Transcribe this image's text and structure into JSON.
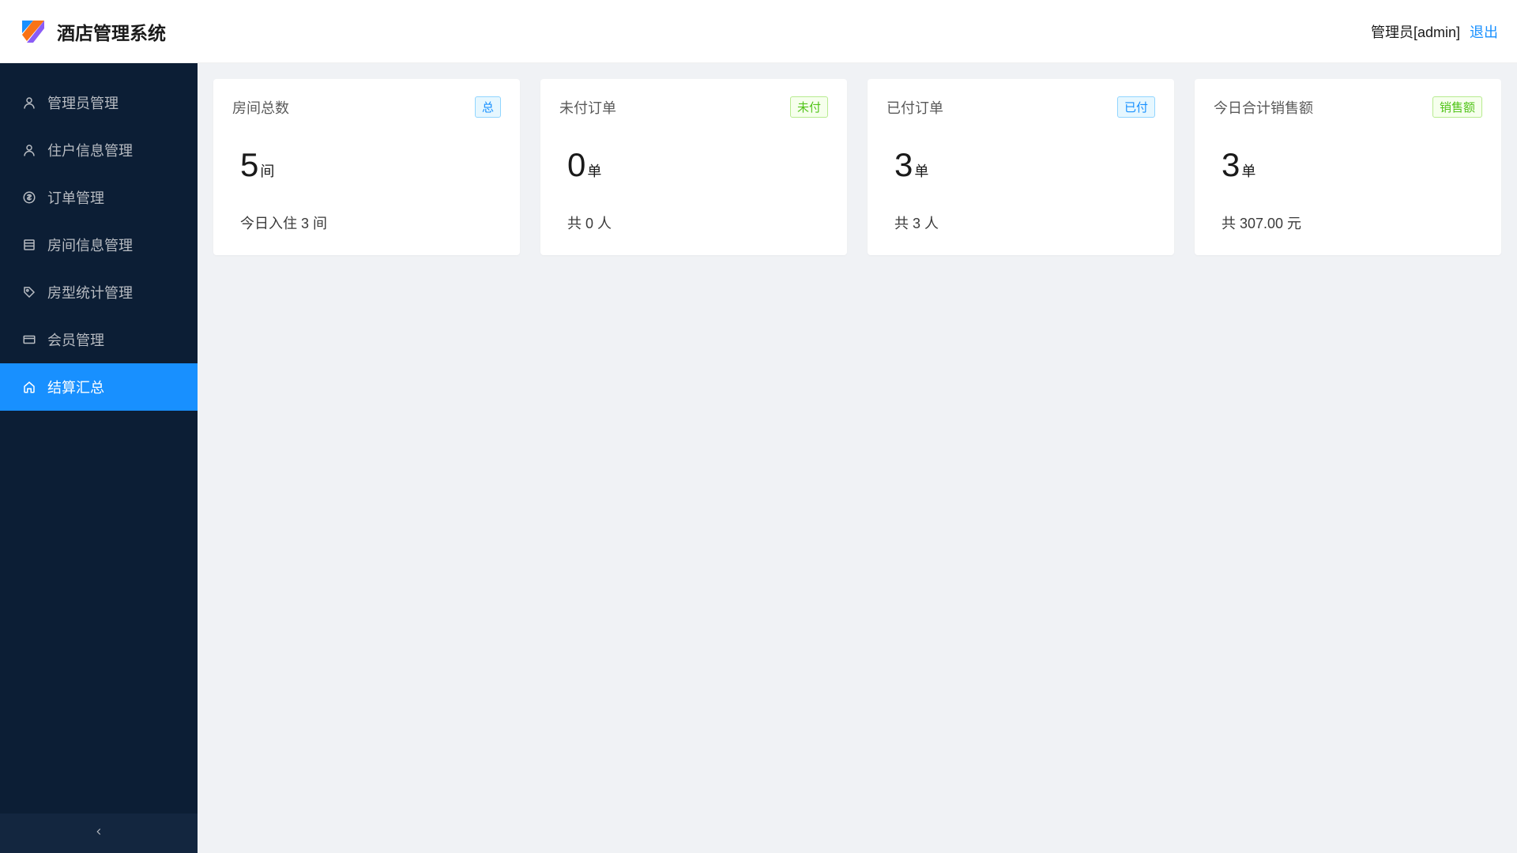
{
  "header": {
    "title": "酒店管理系统",
    "user_label": "管理员[admin]",
    "logout_label": "退出"
  },
  "sidebar": {
    "items": [
      {
        "label": "管理员管理",
        "icon": "user"
      },
      {
        "label": "住户信息管理",
        "icon": "user"
      },
      {
        "label": "订单管理",
        "icon": "dollar"
      },
      {
        "label": "房间信息管理",
        "icon": "list"
      },
      {
        "label": "房型统计管理",
        "icon": "tag"
      },
      {
        "label": "会员管理",
        "icon": "card"
      },
      {
        "label": "结算汇总",
        "icon": "home"
      }
    ],
    "active_index": 6
  },
  "cards": [
    {
      "title": "房间总数",
      "badge": "总",
      "badge_color": "blue",
      "number": "5",
      "unit": "间",
      "footer": "今日入住 3 间"
    },
    {
      "title": "未付订单",
      "badge": "未付",
      "badge_color": "green",
      "number": "0",
      "unit": "单",
      "footer": "共 0 人"
    },
    {
      "title": "已付订单",
      "badge": "已付",
      "badge_color": "blue",
      "number": "3",
      "unit": "单",
      "footer": "共 3 人"
    },
    {
      "title": "今日合计销售额",
      "badge": "销售额",
      "badge_color": "green",
      "number": "3",
      "unit": "单",
      "footer": "共 307.00 元"
    }
  ]
}
